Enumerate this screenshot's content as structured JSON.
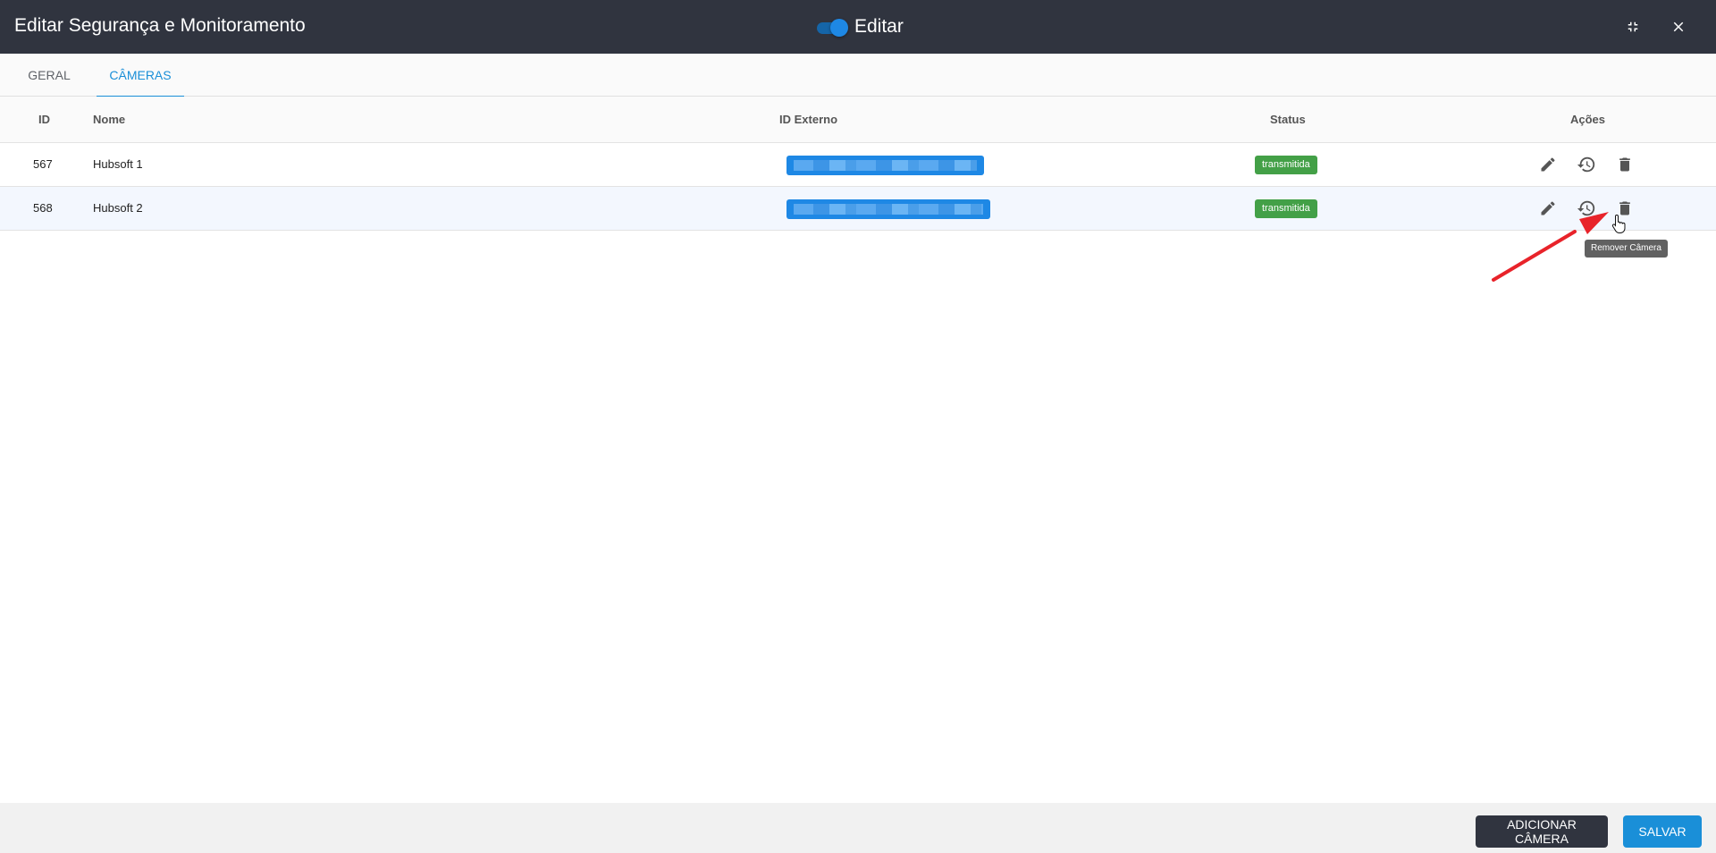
{
  "header": {
    "title": "Editar Segurança e Monitoramento",
    "edit_toggle_label": "Editar",
    "edit_toggle_on": true
  },
  "tabs": [
    {
      "label": "GERAL",
      "active": false
    },
    {
      "label": "CÂMERAS",
      "active": true
    }
  ],
  "table": {
    "columns": {
      "id": "ID",
      "name": "Nome",
      "external_id": "ID Externo",
      "status": "Status",
      "actions": "Ações"
    },
    "rows": [
      {
        "id": "567",
        "name": "Hubsoft 1",
        "status": "transmitida"
      },
      {
        "id": "568",
        "name": "Hubsoft 2",
        "status": "transmitida"
      }
    ]
  },
  "tooltip": "Remover Câmera",
  "footer": {
    "add_camera": "ADICIONAR CÂMERA",
    "save": "SALVAR"
  },
  "icons": {
    "collapse": "fullscreen-exit-icon",
    "close": "close-icon",
    "edit": "pencil-icon",
    "history": "history-icon",
    "delete": "trash-icon"
  },
  "colors": {
    "header_bg": "#30343f",
    "accent": "#1a8fd8",
    "status_ok": "#43a047",
    "redacted": "#1e88e5",
    "annotation_arrow": "#e8232a"
  }
}
